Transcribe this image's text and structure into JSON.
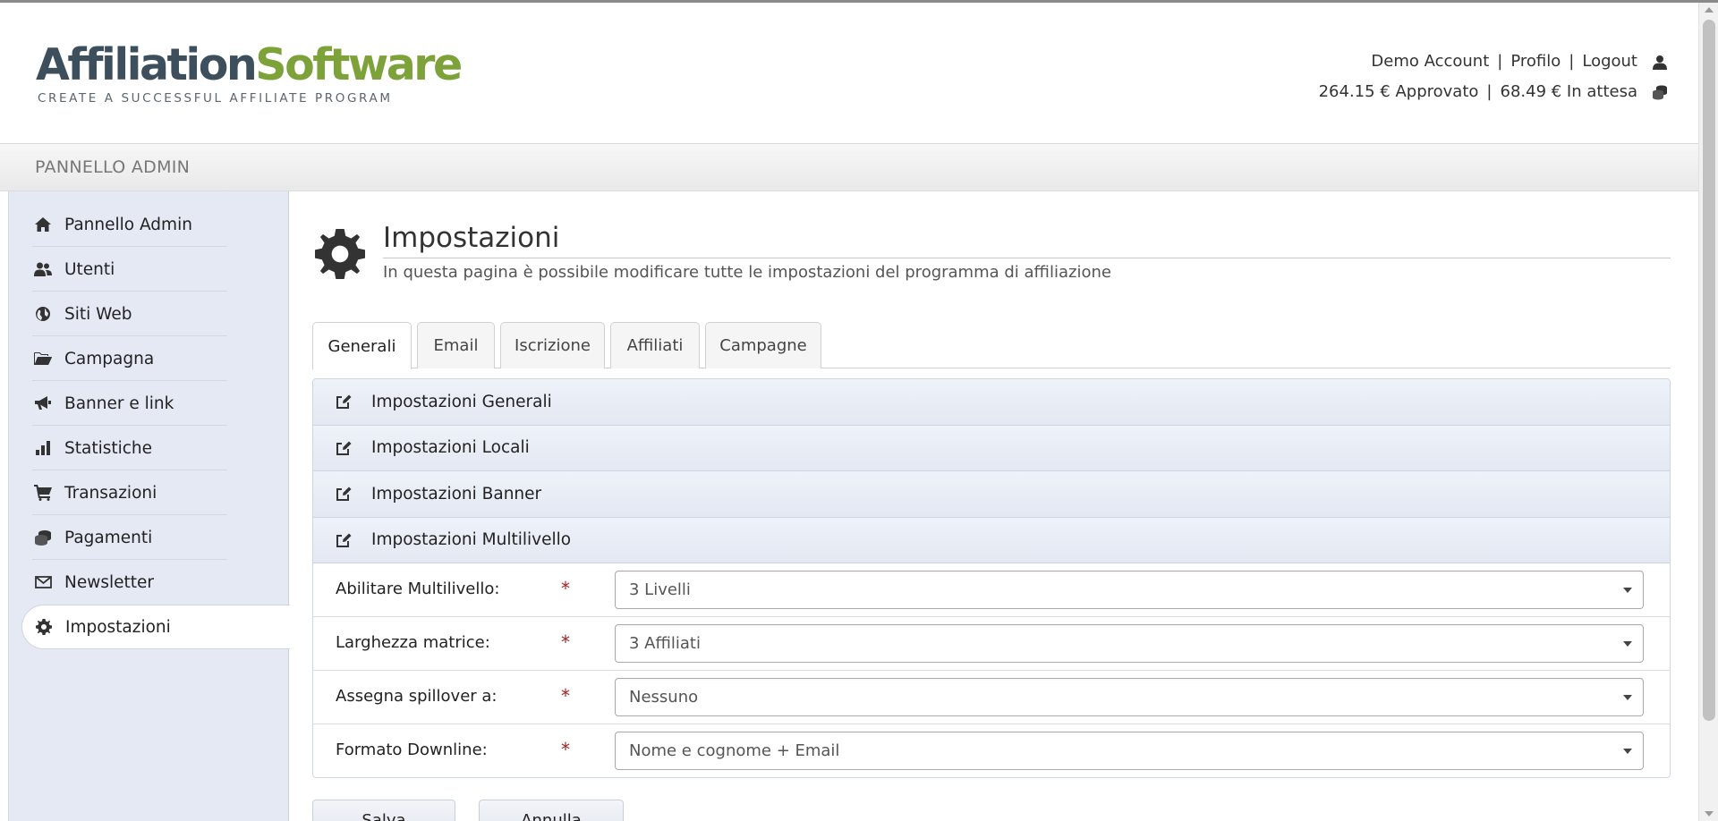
{
  "logo": {
    "part1": "Affiliation",
    "part2": "Software",
    "tagline": "CREATE A SUCCESSFUL AFFILIATE PROGRAM"
  },
  "user": {
    "account": "Demo Account",
    "profile": "Profilo",
    "logout": "Logout",
    "approved": "264.15 € Approvato",
    "pending": "68.49 € In attesa",
    "sep": "|"
  },
  "adminbar": {
    "title": "PANNELLO ADMIN"
  },
  "sidebar": {
    "items": [
      {
        "label": "Pannello Admin",
        "icon": "home-icon"
      },
      {
        "label": "Utenti",
        "icon": "users-icon"
      },
      {
        "label": "Siti Web",
        "icon": "globe-icon"
      },
      {
        "label": "Campagna",
        "icon": "folder-icon"
      },
      {
        "label": "Banner e link",
        "icon": "megaphone-icon"
      },
      {
        "label": "Statistiche",
        "icon": "bar-chart-icon"
      },
      {
        "label": "Transazioni",
        "icon": "cart-icon"
      },
      {
        "label": "Pagamenti",
        "icon": "coins-icon"
      },
      {
        "label": "Newsletter",
        "icon": "envelope-icon"
      },
      {
        "label": "Impostazioni",
        "icon": "gear-icon",
        "active": true
      }
    ]
  },
  "page": {
    "title": "Impostazioni",
    "subtitle": "In questa pagina è possibile modificare tutte le impostazioni del programma di affiliazione"
  },
  "tabs": [
    {
      "label": "Generali",
      "active": true
    },
    {
      "label": "Email"
    },
    {
      "label": "Iscrizione"
    },
    {
      "label": "Affiliati"
    },
    {
      "label": "Campagne"
    }
  ],
  "sections": [
    "Impostazioni Generali",
    "Impostazioni Locali",
    "Impostazioni Banner",
    "Impostazioni Multilivello"
  ],
  "fields": [
    {
      "label": "Abilitare Multilivello:",
      "required": "*",
      "value": "3 Livelli"
    },
    {
      "label": "Larghezza matrice:",
      "required": "*",
      "value": "3 Affiliati"
    },
    {
      "label": "Assegna spillover a:",
      "required": "*",
      "value": "Nessuno"
    },
    {
      "label": "Formato Downline:",
      "required": "*",
      "value": "Nome e cognome + Email"
    }
  ],
  "buttons": {
    "save": "Salva",
    "cancel": "Annulla"
  },
  "colors": {
    "logo_dark": "#3d4f5c",
    "logo_green": "#7da23a",
    "sidebar_bg": "#e4e9f3",
    "required": "#a31f1f"
  }
}
